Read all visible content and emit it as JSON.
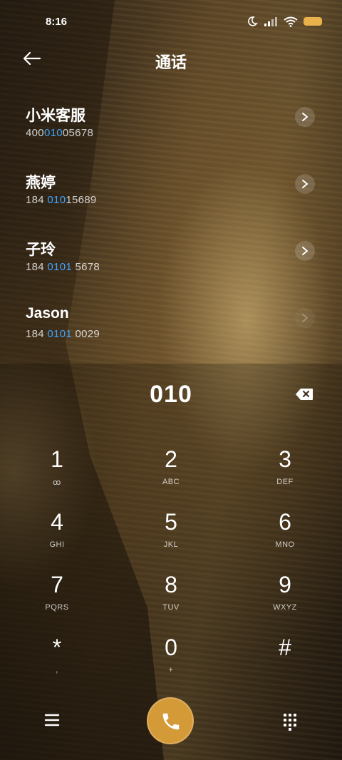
{
  "status": {
    "time": "8:16"
  },
  "header": {
    "title": "通话"
  },
  "results": [
    {
      "name": "小米客服",
      "num_pre": "400",
      "num_hl": "010",
      "num_post": "05678"
    },
    {
      "name": "燕婷",
      "num_pre": "184 ",
      "num_hl": "010",
      "num_post": "15689"
    },
    {
      "name": "子玲",
      "num_pre": "184 ",
      "num_hl": "0101",
      "num_post": " 5678"
    },
    {
      "name": "Jason",
      "num_pre": "184 ",
      "num_hl": "0101",
      "num_post": " 0029"
    }
  ],
  "dialer": {
    "entry": "010",
    "keys": [
      {
        "digit": "1",
        "letters": "ꝏ"
      },
      {
        "digit": "2",
        "letters": "ABC"
      },
      {
        "digit": "3",
        "letters": "DEF"
      },
      {
        "digit": "4",
        "letters": "GHI"
      },
      {
        "digit": "5",
        "letters": "JKL"
      },
      {
        "digit": "6",
        "letters": "MNO"
      },
      {
        "digit": "7",
        "letters": "PQRS"
      },
      {
        "digit": "8",
        "letters": "TUV"
      },
      {
        "digit": "9",
        "letters": "WXYZ"
      },
      {
        "digit": "*",
        "letters": ","
      },
      {
        "digit": "0",
        "letters": "+"
      },
      {
        "digit": "#",
        "letters": ""
      }
    ]
  },
  "icons": {
    "back": "back-arrow-icon",
    "backspace": "backspace-icon",
    "menu": "menu-icon",
    "call": "phone-icon",
    "dialpad": "dialpad-icon",
    "moon": "do-not-disturb-icon",
    "signal": "signal-icon",
    "wifi": "wifi-icon",
    "battery": "battery-icon"
  },
  "colors": {
    "accent": "#3fa5ff",
    "call_button": "#d59a38"
  }
}
